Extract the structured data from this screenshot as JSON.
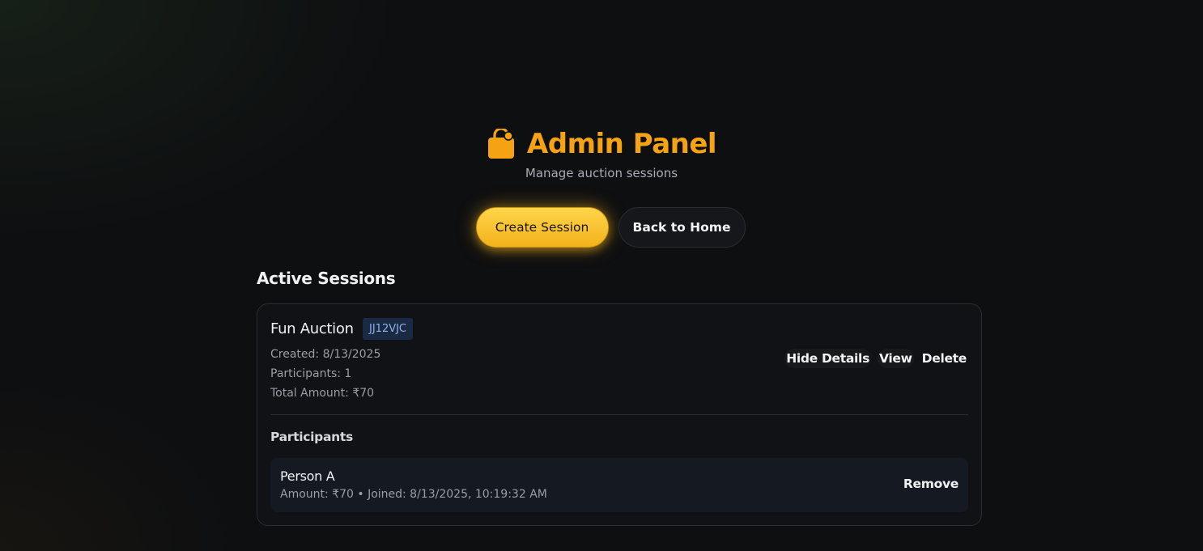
{
  "header": {
    "icon": "shopping-bag-icon",
    "title": "Admin Panel",
    "subtitle": "Manage auction sessions",
    "accent_color": "#f6a313"
  },
  "buttons": {
    "create": "Create Session",
    "back": "Back to Home"
  },
  "section": {
    "title": "Active Sessions"
  },
  "session": {
    "name": "Fun Auction",
    "code": "JJ12VJC",
    "created": "Created: 8/13/2025",
    "participants": "Participants: 1",
    "total": "Total Amount: ₹70",
    "actions": {
      "hide_details": "Hide Details",
      "view": "View",
      "delete": "Delete"
    },
    "participants_title": "Participants",
    "participant_list": [
      {
        "name": "Person A",
        "meta": "Amount: ₹70 • Joined: 8/13/2025, 10:19:32 AM",
        "remove": "Remove"
      }
    ]
  }
}
